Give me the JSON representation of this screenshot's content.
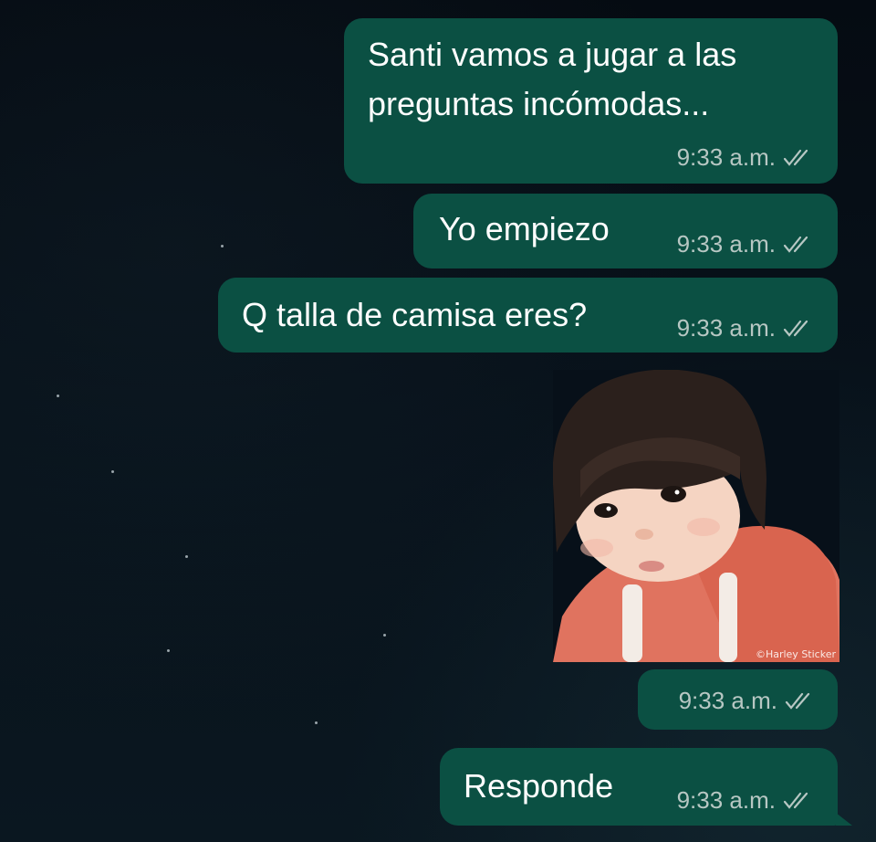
{
  "conversation": {
    "messages": [
      {
        "type": "text",
        "direction": "outgoing",
        "lines": [
          "Santi vamos a jugar a las",
          "preguntas incómodas..."
        ],
        "time": "9:33 a.m.",
        "status_icon": "double-check-icon"
      },
      {
        "type": "text",
        "direction": "outgoing",
        "text": "Yo empiezo",
        "time": "9:33 a.m.",
        "status_icon": "double-check-icon"
      },
      {
        "type": "text",
        "direction": "outgoing",
        "text": "Q talla de camisa eres?",
        "time": "9:33 a.m.",
        "status_icon": "double-check-icon"
      },
      {
        "type": "sticker",
        "direction": "outgoing",
        "watermark": "©Harley Sticker",
        "time": "9:33 a.m.",
        "status_icon": "double-check-icon"
      },
      {
        "type": "text",
        "direction": "outgoing",
        "text": "Responde",
        "time": "9:33 a.m.",
        "status_icon": "double-check-icon"
      }
    ]
  },
  "colors": {
    "bubble_outgoing": "#0b5043",
    "timestamp": "#b7c7c3",
    "background": "#071019"
  }
}
